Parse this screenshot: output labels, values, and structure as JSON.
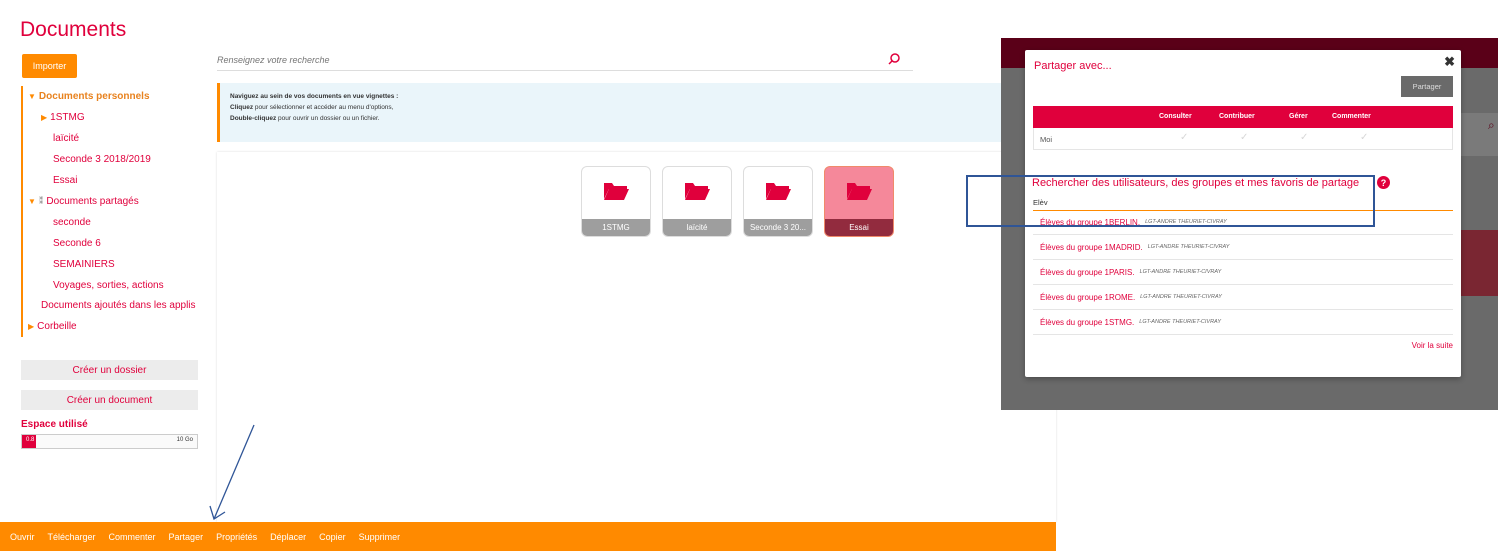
{
  "app": {
    "title": "Documents",
    "import_label": "Importer",
    "search_placeholder": "Renseignez votre recherche",
    "tree": {
      "personal": "Documents personnels",
      "personal_items": [
        "1STMG",
        "laïcité",
        "Seconde 3 2018/2019",
        "Essai"
      ],
      "shared": "Documents partagés",
      "shared_items": [
        "seconde",
        "Seconde 6",
        "SEMAINIERS",
        "Voyages, sorties, actions"
      ],
      "apps": "Documents ajoutés dans les applis",
      "trash": "Corbeille"
    },
    "create_folder": "Créer un dossier",
    "create_document": "Créer un document",
    "space": {
      "label": "Espace utilisé",
      "used": "0.8",
      "total": "10 Go",
      "fill_fraction": 0.08
    },
    "info": {
      "line1": "Naviguez au sein de vos documents en vue vignettes :",
      "line2_bold": "Cliquez",
      "line2_rest": " pour sélectionner et accéder au menu d'options,",
      "line3_bold": "Double-cliquez",
      "line3_rest": " pour ouvrir un dossier ou un fichier."
    },
    "folders": [
      {
        "label": "1STMG",
        "selected": false
      },
      {
        "label": "laïcité",
        "selected": false
      },
      {
        "label": "Seconde 3 20...",
        "selected": false
      },
      {
        "label": "Essai",
        "selected": true
      }
    ],
    "bottom_actions": [
      "Ouvrir",
      "Télécharger",
      "Commenter",
      "Partager",
      "Propriétés",
      "Déplacer",
      "Copier",
      "Supprimer"
    ],
    "colors": {
      "accent": "#ff8a00",
      "brand": "#e0003c",
      "annotation": "#2f5597"
    }
  },
  "share_dialog": {
    "title": "Partager avec...",
    "share_button": "Partager",
    "columns": [
      "Consulter",
      "Contribuer",
      "Gérer",
      "Commenter"
    ],
    "rows": [
      {
        "who": "Moi"
      }
    ],
    "search_title": "Rechercher des utilisateurs, des groupes et mes favoris de partage",
    "search_value": "Elèv",
    "results": [
      {
        "name": "Élèves du groupe 1BERLIN.",
        "school": "LGT-ANDRE THEURIET-CIVRAY"
      },
      {
        "name": "Élèves du groupe 1MADRID.",
        "school": "LGT-ANDRE THEURIET-CIVRAY"
      },
      {
        "name": "Élèves du groupe 1PARIS.",
        "school": "LGT-ANDRE THEURIET-CIVRAY"
      },
      {
        "name": "Élèves du groupe 1ROME.",
        "school": "LGT-ANDRE THEURIET-CIVRAY"
      },
      {
        "name": "Élèves du groupe 1STMG.",
        "school": "LGT-ANDRE THEURIET-CIVRAY"
      }
    ],
    "see_more": "Voir la suite"
  }
}
